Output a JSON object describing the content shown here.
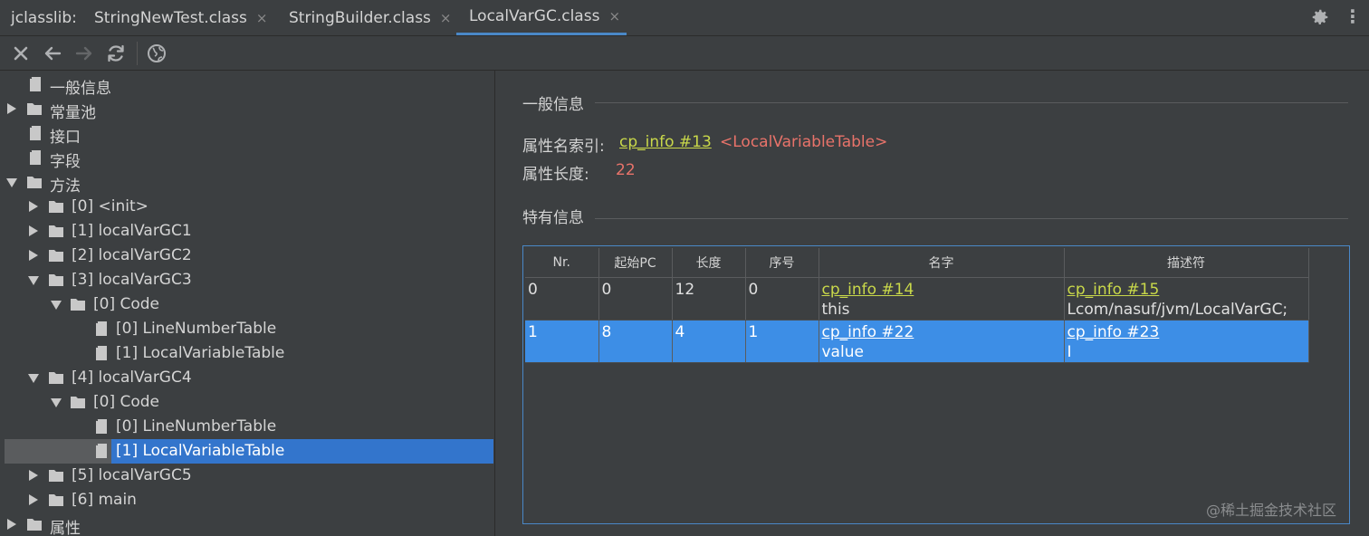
{
  "tabbar": {
    "prefix": "jclasslib:",
    "tabs": [
      {
        "label": "StringNewTest.class",
        "active": false
      },
      {
        "label": "StringBuilder.class",
        "active": false
      },
      {
        "label": "LocalVarGC.class",
        "active": true
      }
    ],
    "close_glyph": "×",
    "settings_icon": "gear-icon",
    "more_label": "⋮"
  },
  "toolbar": {
    "buttons": [
      "close-icon",
      "back-arrow-icon",
      "forward-arrow-icon",
      "refresh-icon",
      "web-icon"
    ]
  },
  "tree": {
    "nodes": [
      {
        "label": "一般信息",
        "type": "file"
      },
      {
        "label": "常量池",
        "type": "folder",
        "expanded": false
      },
      {
        "label": "接口",
        "type": "file"
      },
      {
        "label": "字段",
        "type": "file"
      },
      {
        "label": "方法",
        "type": "folder",
        "expanded": true
      },
      {
        "label": "[0] <init>",
        "type": "folder",
        "expanded": false
      },
      {
        "label": "[1] localVarGC1",
        "type": "folder",
        "expanded": false
      },
      {
        "label": "[2] localVarGC2",
        "type": "folder",
        "expanded": false
      },
      {
        "label": "[3] localVarGC3",
        "type": "folder",
        "expanded": true
      },
      {
        "label": "[0] Code",
        "type": "folder",
        "expanded": true
      },
      {
        "label": "[0] LineNumberTable",
        "type": "file"
      },
      {
        "label": "[1] LocalVariableTable",
        "type": "file"
      },
      {
        "label": "[4] localVarGC4",
        "type": "folder",
        "expanded": true
      },
      {
        "label": "[0] Code",
        "type": "folder",
        "expanded": true
      },
      {
        "label": "[0] LineNumberTable",
        "type": "file"
      },
      {
        "label": "[1] LocalVariableTable",
        "type": "file",
        "selected": true
      },
      {
        "label": "[5] localVarGC5",
        "type": "folder",
        "expanded": false
      },
      {
        "label": "[6] main",
        "type": "folder",
        "expanded": false
      },
      {
        "label": "属性",
        "type": "folder",
        "expanded": false
      }
    ]
  },
  "general": {
    "section_title": "一般信息",
    "attr_name_key": "属性名索引:",
    "attr_name_link": "cp_info #13",
    "attr_name_value": "<LocalVariableTable>",
    "attr_len_key": "属性长度:",
    "attr_len_value": "22"
  },
  "specific": {
    "section_title": "特有信息",
    "columns": [
      "Nr.",
      "起始PC",
      "长度",
      "序号",
      "名字",
      "描述符"
    ],
    "rows": [
      {
        "nr": "0",
        "start_pc": "0",
        "length": "12",
        "index": "0",
        "name_link": "cp_info #14",
        "name_value": "this",
        "desc_link": "cp_info #15",
        "desc_value": "Lcom/nasuf/jvm/LocalVarGC;"
      },
      {
        "nr": "1",
        "start_pc": "8",
        "length": "4",
        "index": "1",
        "name_link": "cp_info #22",
        "name_value": "value",
        "desc_link": "cp_info #23",
        "desc_value": "I",
        "selected": true
      }
    ]
  },
  "watermark": "@稀土掘金技术社区",
  "colors": {
    "accent": "#4a88c7",
    "selection": "#3375cc",
    "link": "#c9d84a",
    "value_red": "#e8736a"
  }
}
